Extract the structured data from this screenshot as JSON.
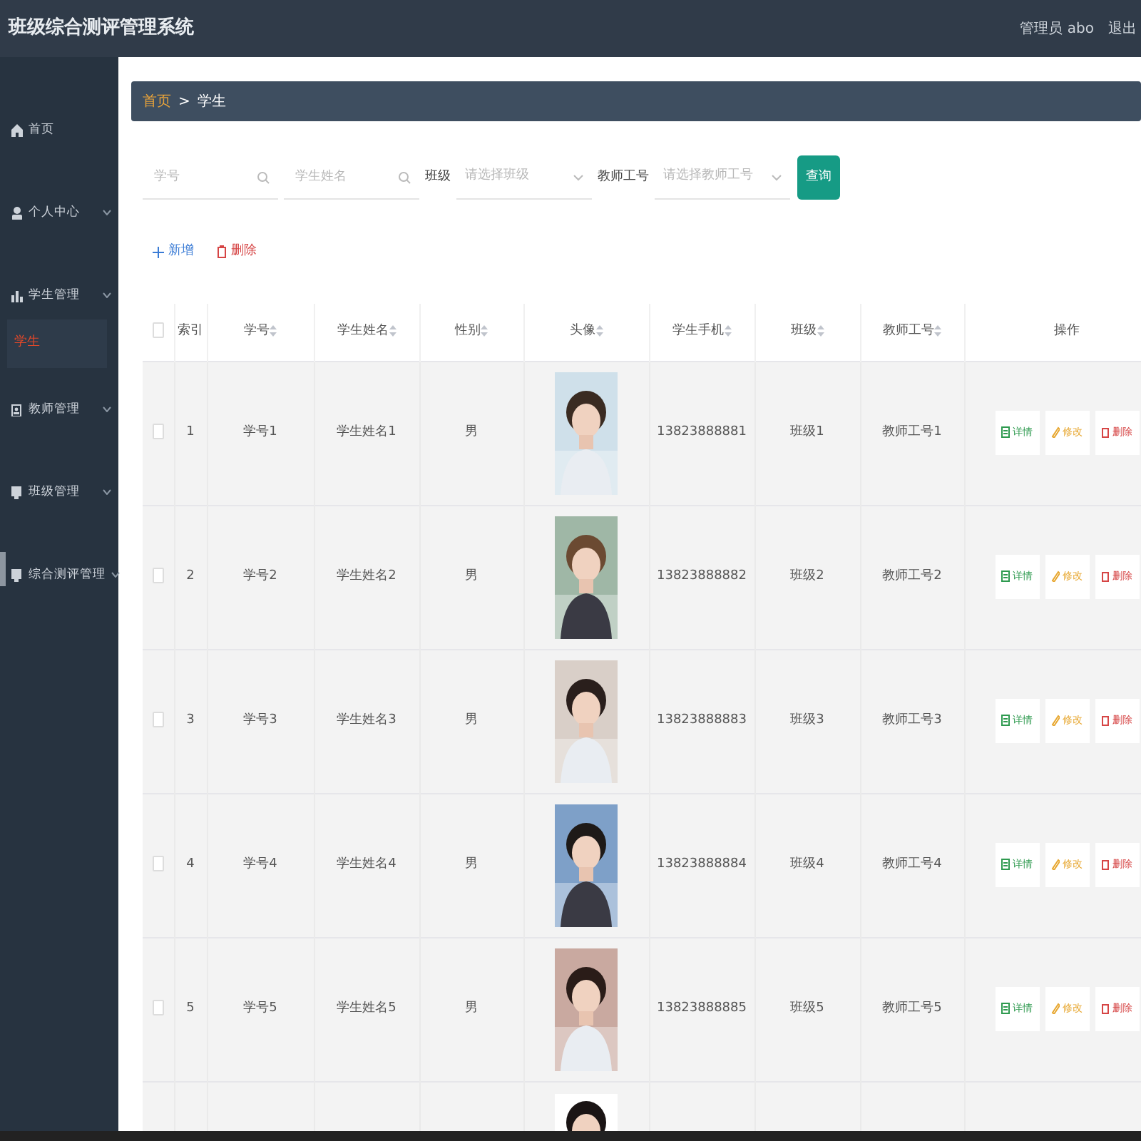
{
  "header": {
    "title": "班级综合测评管理系统",
    "user": "管理员 abo",
    "logout": "退出"
  },
  "sidebar": {
    "items": [
      {
        "label": "首页",
        "has_submenu": false,
        "selected": false
      },
      {
        "label": "个人中心",
        "has_submenu": true,
        "selected": false
      },
      {
        "label": "学生管理",
        "has_submenu": true,
        "selected": false,
        "children": [
          {
            "label": "学生",
            "selected": true
          }
        ]
      },
      {
        "label": "教师管理",
        "has_submenu": true,
        "selected": false
      },
      {
        "label": "班级管理",
        "has_submenu": true,
        "selected": false
      },
      {
        "label": "综合测评管理",
        "has_submenu": true,
        "selected": false
      }
    ]
  },
  "breadcrumb": [
    {
      "label": "首页",
      "kind": "link"
    },
    {
      "label": "学生",
      "kind": "current"
    }
  ],
  "breadcrumb_separator": ">",
  "filters": [
    {
      "kind": "search",
      "placeholder": "学号"
    },
    {
      "kind": "search",
      "placeholder": "学生姓名"
    },
    {
      "kind": "select",
      "label": "班级",
      "placeholder": "请选择班级"
    },
    {
      "kind": "select",
      "label": "教师工号",
      "placeholder": "请选择教师工号"
    }
  ],
  "query_button": "查询",
  "toolbar": [
    {
      "label": "新增",
      "kind": "add"
    },
    {
      "label": "删除",
      "kind": "delete"
    }
  ],
  "table": {
    "columns": [
      {
        "kind": "checkbox",
        "checked": false
      },
      {
        "label": "索引",
        "kind": "plain"
      },
      {
        "label": "学号",
        "kind": "sortable"
      },
      {
        "label": "学生姓名",
        "kind": "sortable"
      },
      {
        "label": "性别",
        "kind": "sortable"
      },
      {
        "label": "头像",
        "kind": "sortable"
      },
      {
        "label": "学生手机",
        "kind": "sortable"
      },
      {
        "label": "班级",
        "kind": "sortable"
      },
      {
        "label": "教师工号",
        "kind": "sortable"
      },
      {
        "label": "操作",
        "kind": "plain"
      }
    ],
    "rows": [
      {
        "checked": false,
        "index": "1",
        "student_no": "学号1",
        "name": "学生姓名1",
        "gender": "男",
        "avatar": {
          "kind": "picture"
        },
        "phone": "13823888881",
        "class": "班级1",
        "teacher_no": "教师工号1",
        "actions": [
          {
            "label": "详情",
            "kind": "detail"
          },
          {
            "label": "修改",
            "kind": "edit"
          },
          {
            "label": "删除",
            "kind": "delete"
          }
        ]
      },
      {
        "checked": false,
        "index": "2",
        "student_no": "学号2",
        "name": "学生姓名2",
        "gender": "男",
        "avatar": {
          "kind": "picture"
        },
        "phone": "13823888882",
        "class": "班级2",
        "teacher_no": "教师工号2",
        "actions": [
          {
            "label": "详情",
            "kind": "detail"
          },
          {
            "label": "修改",
            "kind": "edit"
          },
          {
            "label": "删除",
            "kind": "delete"
          }
        ]
      },
      {
        "checked": false,
        "index": "3",
        "student_no": "学号3",
        "name": "学生姓名3",
        "gender": "男",
        "avatar": {
          "kind": "picture"
        },
        "phone": "13823888883",
        "class": "班级3",
        "teacher_no": "教师工号3",
        "actions": [
          {
            "label": "详情",
            "kind": "detail"
          },
          {
            "label": "修改",
            "kind": "edit"
          },
          {
            "label": "删除",
            "kind": "delete"
          }
        ]
      },
      {
        "checked": false,
        "index": "4",
        "student_no": "学号4",
        "name": "学生姓名4",
        "gender": "男",
        "avatar": {
          "kind": "picture"
        },
        "phone": "13823888884",
        "class": "班级4",
        "teacher_no": "教师工号4",
        "actions": [
          {
            "label": "详情",
            "kind": "detail"
          },
          {
            "label": "修改",
            "kind": "edit"
          },
          {
            "label": "删除",
            "kind": "delete"
          }
        ]
      },
      {
        "checked": false,
        "index": "5",
        "student_no": "学号5",
        "name": "学生姓名5",
        "gender": "男",
        "avatar": {
          "kind": "picture"
        },
        "phone": "13823888885",
        "class": "班级5",
        "teacher_no": "教师工号5",
        "actions": [
          {
            "label": "详情",
            "kind": "detail"
          },
          {
            "label": "修改",
            "kind": "edit"
          },
          {
            "label": "删除",
            "kind": "delete"
          }
        ]
      },
      {
        "partial": true,
        "avatar": {
          "kind": "picture"
        }
      }
    ]
  }
}
